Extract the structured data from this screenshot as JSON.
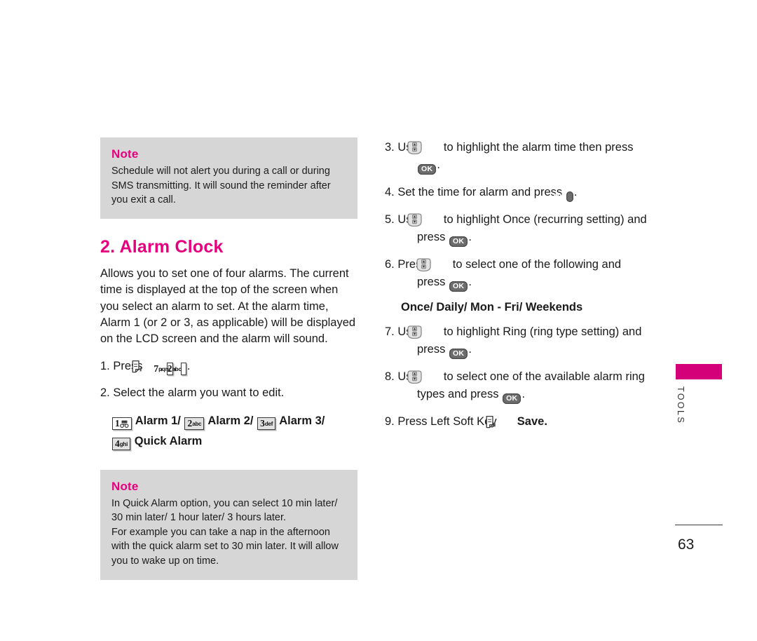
{
  "document": {
    "page_number": "63",
    "edge_tab_label": "TOOLS",
    "accent_color": "#e6007e",
    "tab_color": "#d4007a",
    "note_bg_color": "#d6d6d6"
  },
  "left_column": {
    "note_top": {
      "title": "Note",
      "body": "Schedule will not alert you during a call or during SMS transmitting. It will sound the reminder after you exit a call."
    },
    "heading": "2. Alarm Clock",
    "intro": "Allows you to set one of four alarms. The current time is displayed at the top of the screen when you select an alarm to set. At the alarm time, Alarm 1 (or 2 or 3, as applicable) will be displayed on the LCD screen and the alarm will sound.",
    "step1": {
      "number": "1.",
      "text_before": "Press",
      "comma1": ",",
      "comma2": ",",
      "period": ".",
      "key_softkey": "left-soft-key-icon",
      "key_7": {
        "digit": "7",
        "letters": "pqrs"
      },
      "key_2": {
        "digit": "2",
        "letters": "abc"
      }
    },
    "step2": {
      "number": "2.",
      "text": "Select the alarm you want to edit."
    },
    "alarm_options": [
      {
        "key_digit": "1",
        "key_letters": "voicemail-icon",
        "label": "Alarm 1/"
      },
      {
        "key_digit": "2",
        "key_letters": "abc",
        "label": "Alarm 2/"
      },
      {
        "key_digit": "3",
        "key_letters": "def",
        "label": "Alarm 3/"
      },
      {
        "key_digit": "4",
        "key_letters": "ghi",
        "label": "Quick Alarm"
      }
    ],
    "note_bottom": {
      "title": "Note",
      "body_line1": "In Quick Alarm option, you can select 10 min later/ 30 min later/ 1 hour later/ 3 hours later.",
      "body_line2": "For example you can take a nap in the afternoon with the quick alarm set to 30 min later. It will allow you to wake up on time."
    }
  },
  "right_column": {
    "step3": {
      "number": "3.",
      "part1": "Use",
      "part2": "to highlight the alarm time then press",
      "part3": "."
    },
    "step4": {
      "number": "4.",
      "part1": "Set the time for alarm and press",
      "part2": "."
    },
    "step5": {
      "number": "5.",
      "part1": "Use",
      "part2": "to highlight Once (recurring setting) and",
      "part3": "press",
      "part4": "."
    },
    "step6": {
      "number": "6.",
      "part1": "Press",
      "part2": "to select one of the following and",
      "part3": "press",
      "part4": "."
    },
    "options_line": "Once/ Daily/ Mon - Fri/ Weekends",
    "step7": {
      "number": "7.",
      "part1": "Use",
      "part2": "to highlight Ring (ring type setting) and",
      "part3": "press",
      "part4": "."
    },
    "step8": {
      "number": "8.",
      "part1": "Use",
      "part2": "to select one of the available alarm ring",
      "part3": "types and press",
      "part4": "."
    },
    "step9": {
      "number": "9.",
      "part1": "Press Left Soft Key",
      "part2": "Save."
    }
  }
}
